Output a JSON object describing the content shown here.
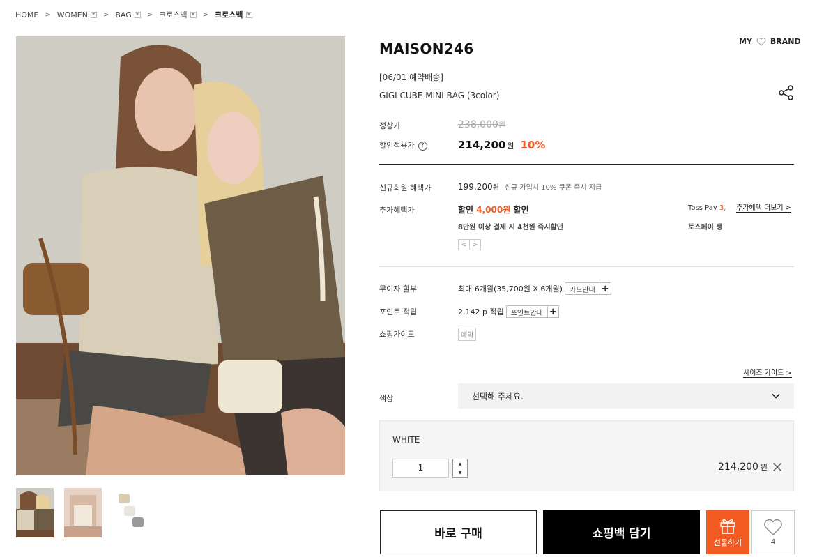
{
  "breadcrumb": [
    {
      "label": "HOME",
      "dropdown": false
    },
    {
      "label": "WOMEN",
      "dropdown": true
    },
    {
      "label": "BAG",
      "dropdown": true
    },
    {
      "label": "크로스백",
      "dropdown": true
    },
    {
      "label": "크로스백",
      "dropdown": true
    }
  ],
  "product": {
    "brand": "MAISON246",
    "shipping_note": "[06/01 예약배송]",
    "name": "GIGI CUBE MINI BAG (3color)"
  },
  "header_links": {
    "my": "MY",
    "brand": "BRAND"
  },
  "price": {
    "regular_label": "정상가",
    "regular_value": "238,000",
    "currency": "원",
    "sale_label": "할인적용가",
    "sale_value": "214,200",
    "discount": "10%"
  },
  "benefits": {
    "member_label": "신규회원 혜택가",
    "member_value": "199,200",
    "member_note": "신규 가입시 10% 쿠폰 즉시 지급",
    "extra_label": "추가혜택가",
    "extra_prefix": "할인 ",
    "extra_amount": "4,000원",
    "extra_suffix": " 할인",
    "extra_sub": "8만원 이상 결제 시 4천원 즉시할인",
    "toss_line1_prefix": "Toss Pay ",
    "toss_line1_hl": "3,",
    "toss_line2": "토스페이 생",
    "more_link": "추가혜택 더보기 >",
    "pager_prev": "<",
    "pager_next": ">"
  },
  "installment": {
    "label": "무이자 할부",
    "value": "최대 6개월(35,700원 X 6개월)",
    "button": "카드안내",
    "plus": "+"
  },
  "points": {
    "label": "포인트 적립",
    "value": "2,142 p 적립",
    "button": "포인트안내",
    "plus": "+"
  },
  "shopping_guide": {
    "label": "쇼핑가이드",
    "badge": "예약"
  },
  "options": {
    "size_guide": "사이즈 가이드 >",
    "color_label": "색상",
    "select_placeholder": "선택해 주세요."
  },
  "selected_option": {
    "name": "WHITE",
    "quantity": "1",
    "price": "214,200",
    "currency": "원",
    "up": "▲",
    "down": "▼"
  },
  "actions": {
    "buy_now": "바로 구매",
    "add_to_cart": "쇼핑백 담기",
    "gift": "선물하기",
    "wish_count": "4"
  },
  "colors": {
    "accent": "#f15b22",
    "dark": "#000000"
  }
}
